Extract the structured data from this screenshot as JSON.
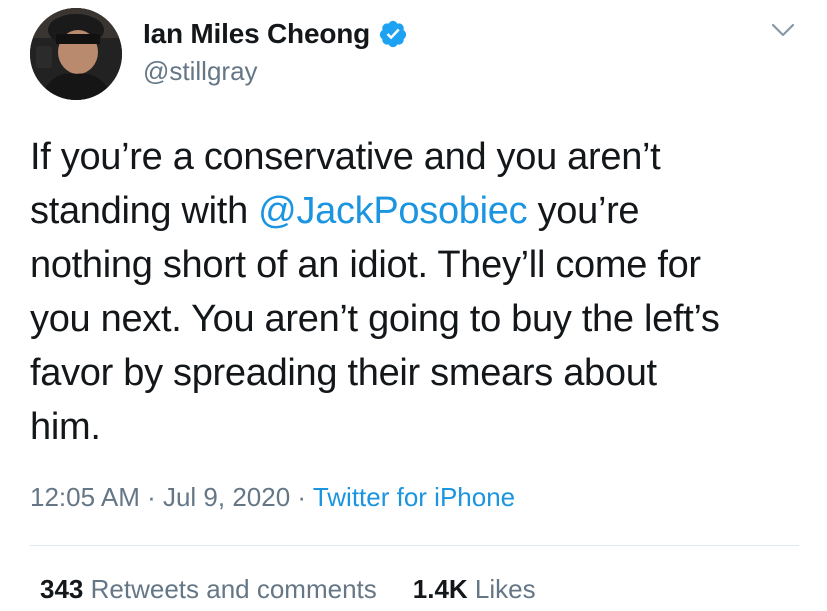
{
  "author": {
    "display_name": "Ian Miles Cheong",
    "handle": "@stillgray",
    "verified": true,
    "avatar": "avatar-photo"
  },
  "icons": {
    "verified": "verified-badge-icon",
    "menu": "chevron-down-icon"
  },
  "tweet": {
    "lines": [
      {
        "before": "If you’re a conservative and you aren’t"
      },
      {
        "before": "standing with ",
        "mention": "@JackPosobiec",
        "after": " you’re"
      },
      {
        "before": "nothing short of an idiot. They’ll come for"
      },
      {
        "before": "you next. You aren’t going to buy the left’s"
      },
      {
        "before": "favor by spreading their smears about"
      },
      {
        "before": "him."
      }
    ]
  },
  "meta": {
    "time": "12:05 AM",
    "separator": " · ",
    "date": "Jul 9, 2020",
    "source": "Twitter for iPhone"
  },
  "stats": {
    "retweets_count": "343",
    "retweets_label": "Retweets and comments",
    "likes_count": "1.4K",
    "likes_label": "Likes"
  },
  "colors": {
    "link": "#1b95e0",
    "secondary_text": "#657786",
    "primary_text": "#14171a",
    "divider": "#e1e8ed"
  }
}
